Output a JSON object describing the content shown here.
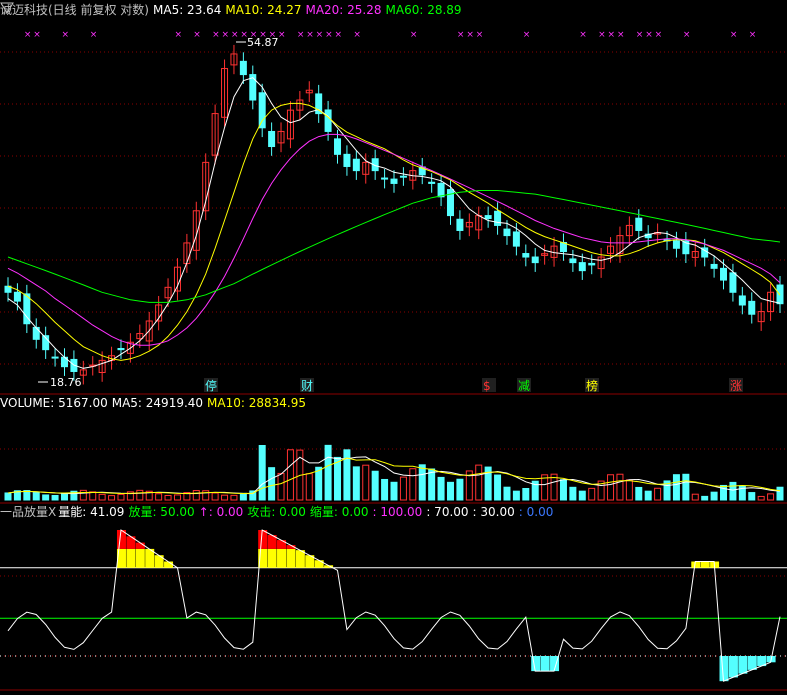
{
  "colors": {
    "bg": "#000000",
    "up": "#ff3232",
    "down": "#54ffff",
    "ma5": "#ffffff",
    "ma10": "#ffff00",
    "ma20": "#ff32ff",
    "ma60": "#00ff00",
    "grid": "#8b0000",
    "legend_title": "#c0c0c0"
  },
  "price_panel": {
    "title": "诚迈科技(日线 前复权 对数)",
    "ma5_label": "MA5: 23.64",
    "ma10_label": "MA10: 24.27",
    "ma20_label": "MA20: 25.28",
    "ma60_label": "MA60: 28.89",
    "high_label": "54.87",
    "low_label": "18.76",
    "event_markers": [
      "停",
      "财",
      "$",
      "减",
      "榜",
      "涨"
    ]
  },
  "volume_panel": {
    "volume_label": "VOLUME: 5167.00",
    "ma5_label": "MA5: 24919.40",
    "ma10_label": "MA10: 28834.95"
  },
  "indicator_panel": {
    "name_label": "一品放量X",
    "energy_label": "量能: 41.09",
    "fangliang_label": "放量: 50.00",
    "up_label": "↑: 0.00",
    "gongji_label": "攻击: 0.00",
    "suoliang_label": "缩量: 0.00",
    "l100_label": ": 100.00",
    "l70_label": ": 70.00",
    "l30_label": ": 30.00",
    "l0_label": ": 0.00"
  },
  "icons": {
    "corner": "expand-triangle-icon",
    "star": "star-marker-icon"
  },
  "chart_data": {
    "type": "candlestick",
    "price": {
      "scale": "log",
      "high": 54.87,
      "low": 18.76,
      "close": [
        24.5,
        23.8,
        22.1,
        21.0,
        20.3,
        19.8,
        19.2,
        18.9,
        19.0,
        19.3,
        19.6,
        19.9,
        20.3,
        20.8,
        21.4,
        22.3,
        23.5,
        24.9,
        26.6,
        28.8,
        32.0,
        37.5,
        44.0,
        51.0,
        53.5,
        50.0,
        46.0,
        42.0,
        39.5,
        41.5,
        44.5,
        46.0,
        47.5,
        44.0,
        41.5,
        38.5,
        37.0,
        36.5,
        37.5,
        36.5,
        35.5,
        35.0,
        35.8,
        36.5,
        36.0,
        35.0,
        33.5,
        31.5,
        30.0,
        30.8,
        31.5,
        31.2,
        30.5,
        29.5,
        28.5,
        27.5,
        27.0,
        27.8,
        28.5,
        28.0,
        27.0,
        26.3,
        26.8,
        27.5,
        28.5,
        29.5,
        30.5,
        30.0,
        29.3,
        29.8,
        29.0,
        28.3,
        27.8,
        28.0,
        27.5,
        26.5,
        25.5,
        24.5,
        23.5,
        22.8,
        23.0,
        24.5,
        23.6
      ],
      "ma5": [
        24.0,
        23.5,
        22.6,
        21.8,
        21.1,
        20.4,
        19.8,
        19.3,
        19.1,
        19.2,
        19.4,
        19.6,
        20.0,
        20.4,
        20.9,
        21.6,
        22.5,
        23.6,
        25.0,
        27.0,
        29.5,
        33.0,
        37.5,
        42.0,
        46.5,
        49.0,
        49.5,
        48.0,
        45.5,
        43.5,
        42.7,
        43.1,
        44.2,
        44.6,
        43.6,
        42.0,
        40.5,
        39.0,
        37.7,
        37.1,
        36.8,
        36.3,
        36.1,
        35.9,
        35.8,
        35.6,
        35.3,
        34.6,
        33.4,
        32.2,
        31.5,
        31.0,
        30.8,
        30.7,
        30.2,
        29.5,
        28.7,
        28.1,
        27.9,
        27.8,
        27.7,
        27.5,
        27.3,
        27.2,
        27.4,
        27.9,
        28.6,
        29.3,
        29.6,
        29.8,
        29.7,
        29.3,
        28.8,
        28.6,
        28.1,
        27.6,
        26.9,
        26.2,
        25.5,
        24.7,
        24.0,
        23.8,
        23.64
      ],
      "ma10": [
        25.0,
        24.7,
        24.2,
        23.6,
        22.9,
        22.2,
        21.6,
        21.0,
        20.5,
        20.2,
        19.9,
        19.7,
        19.6,
        19.7,
        19.9,
        20.2,
        20.6,
        21.2,
        22.0,
        23.0,
        24.3,
        26.0,
        28.3,
        31.0,
        34.0,
        37.3,
        40.5,
        43.0,
        44.5,
        45.2,
        45.5,
        45.5,
        45.2,
        44.5,
        43.5,
        42.3,
        41.4,
        40.8,
        40.2,
        39.7,
        39.2,
        38.5,
        37.8,
        37.2,
        36.8,
        36.4,
        35.9,
        35.4,
        34.7,
        34.0,
        33.4,
        32.8,
        32.1,
        31.5,
        30.9,
        30.3,
        29.8,
        29.4,
        29.1,
        28.8,
        28.5,
        28.2,
        27.9,
        27.7,
        27.6,
        27.6,
        27.8,
        28.1,
        28.5,
        28.8,
        29.0,
        29.1,
        29.1,
        29.0,
        28.7,
        28.3,
        27.9,
        27.4,
        26.9,
        26.4,
        25.9,
        25.3,
        24.27
      ],
      "ma20": [
        26.5,
        26.1,
        25.6,
        25.1,
        24.6,
        24.0,
        23.5,
        23.0,
        22.5,
        22.0,
        21.6,
        21.2,
        20.9,
        20.7,
        20.6,
        20.6,
        20.7,
        20.9,
        21.3,
        21.8,
        22.5,
        23.4,
        24.5,
        25.8,
        27.4,
        29.2,
        31.2,
        33.2,
        35.0,
        36.6,
        38.0,
        39.2,
        40.2,
        40.8,
        41.1,
        41.1,
        40.9,
        40.5,
        40.0,
        39.5,
        39.0,
        38.5,
        38.0,
        37.5,
        37.0,
        36.5,
        36.0,
        35.5,
        35.0,
        34.5,
        34.0,
        33.5,
        33.0,
        32.5,
        32.0,
        31.5,
        31.0,
        30.6,
        30.2,
        29.9,
        29.6,
        29.3,
        29.1,
        28.9,
        28.8,
        28.8,
        28.8,
        28.9,
        29.0,
        29.1,
        29.2,
        29.2,
        29.1,
        28.9,
        28.7,
        28.4,
        28.1,
        27.7,
        27.3,
        26.9,
        26.5,
        26.0,
        25.28
      ],
      "ma60": [
        27.5,
        27.2,
        26.9,
        26.6,
        26.3,
        26.0,
        25.7,
        25.4,
        25.1,
        24.8,
        24.5,
        24.3,
        24.1,
        23.9,
        23.8,
        23.7,
        23.7,
        23.7,
        23.8,
        23.9,
        24.1,
        24.3,
        24.6,
        24.9,
        25.2,
        25.6,
        26.0,
        26.4,
        26.8,
        27.2,
        27.6,
        28.0,
        28.4,
        28.8,
        29.2,
        29.6,
        30.0,
        30.4,
        30.8,
        31.2,
        31.6,
        32.0,
        32.4,
        32.8,
        33.1,
        33.4,
        33.6,
        33.8,
        34.0,
        34.1,
        34.2,
        34.2,
        34.2,
        34.1,
        34.0,
        33.9,
        33.8,
        33.6,
        33.4,
        33.2,
        33.0,
        32.8,
        32.6,
        32.4,
        32.2,
        32.0,
        31.8,
        31.6,
        31.4,
        31.2,
        31.0,
        30.8,
        30.6,
        30.4,
        30.2,
        30.0,
        29.8,
        29.6,
        29.4,
        29.2,
        29.1,
        29.0,
        28.89
      ]
    },
    "volume": {
      "latest": 5167.0,
      "ma5": 24919.4,
      "ma10": 28834.95
    },
    "indicator": {
      "series": [
        "量能",
        "放量",
        "↑",
        "攻击",
        "缩量"
      ],
      "latest": {
        "量能": 41.09,
        "放量": 50.0,
        "↑": 0.0,
        "攻击": 0.0,
        "缩量": 0.0
      },
      "levels": [
        100,
        70,
        30,
        0
      ]
    }
  }
}
